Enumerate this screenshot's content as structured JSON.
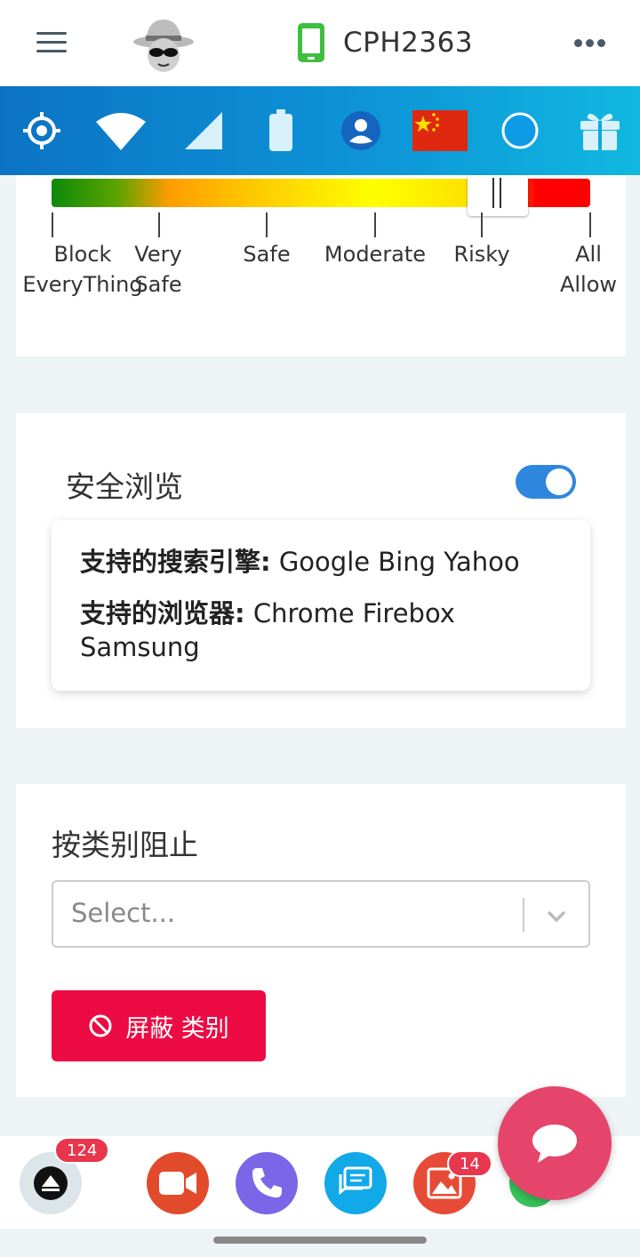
{
  "header": {
    "device_name": "CPH2363"
  },
  "icons": {
    "menu": "hamburger-menu-icon",
    "avatar": "spy-avatar-icon",
    "device": "phone-icon",
    "more": "more-dots-icon",
    "status": [
      "location-icon",
      "wifi-icon",
      "signal-icon",
      "battery-icon",
      "user-icon",
      "china-flag-icon",
      "circle-icon",
      "gift-icon"
    ]
  },
  "colors": {
    "accent_blue": "#0e96d8",
    "toggle_on": "#2f86de",
    "danger_button": "#ec0b43",
    "fab": "#e5456a"
  },
  "safety_slider": {
    "level_fraction": 0.88,
    "labels": [
      "Block EveryThing",
      "Very Safe",
      "Safe",
      "Moderate",
      "Risky",
      "All Allow"
    ],
    "label_lines": [
      [
        "Block",
        "EveryThing"
      ],
      [
        "Very",
        "Safe"
      ],
      [
        "Safe"
      ],
      [
        "Moderate"
      ],
      [
        "Risky"
      ],
      [
        "All",
        "Allow"
      ]
    ]
  },
  "safe_browsing": {
    "title": "安全浏览",
    "enabled": true,
    "engines_label": "支持的搜索引擎:",
    "engines_value": " Google Bing Yahoo",
    "browsers_label": "支持的浏览器:",
    "browsers_value": " Chrome Firebox Samsung"
  },
  "category_block": {
    "title": "按类别阻止",
    "select_placeholder": "Select...",
    "button_label": "屏蔽 类别"
  },
  "bottom_apps": [
    {
      "name": "notifications",
      "badge": "124"
    },
    {
      "name": "video"
    },
    {
      "name": "phone"
    },
    {
      "name": "messages"
    },
    {
      "name": "gallery",
      "badge": "14"
    },
    {
      "name": "whatsapp"
    }
  ]
}
